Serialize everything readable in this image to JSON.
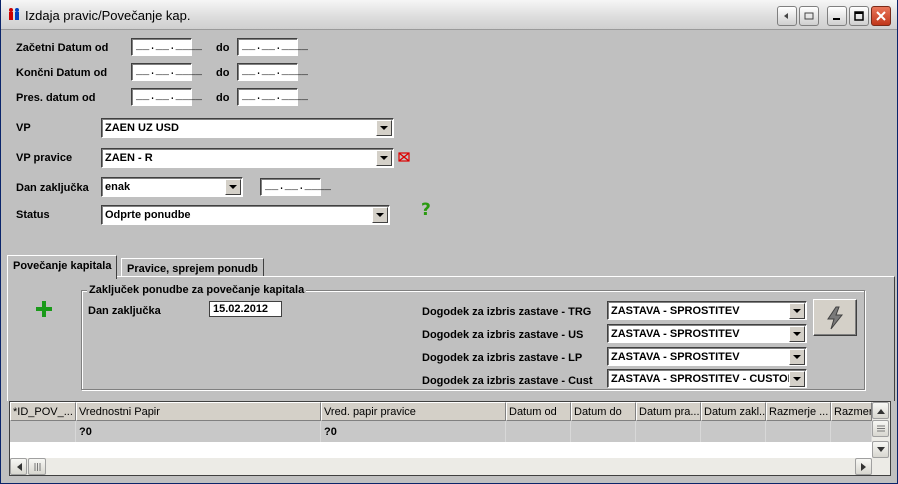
{
  "window": {
    "title": "Izdaja pravic/Povečanje kap.",
    "accent": "#0a246a"
  },
  "filters": {
    "zacetni_datum_label": "Začetni Datum  od",
    "koncni_datum_label": "Končni Datum od",
    "pres_datum_label": "Pres. datum od",
    "do_label": "do",
    "date_placeholder": "__.__.____"
  },
  "vp": {
    "label": "VP",
    "value": "ZAEN UZ USD"
  },
  "vp_pravice": {
    "label": "VP pravice",
    "value": "ZAEN - R"
  },
  "dan_zakljucka": {
    "label": "Dan zaključka",
    "operator": "enak",
    "date": "__.__.____"
  },
  "status": {
    "label": "Status",
    "value": "Odprte ponudbe"
  },
  "tabs": [
    {
      "label": "Povečanje kapitala",
      "active": true
    },
    {
      "label": "Pravice, sprejem ponudb",
      "active": false
    }
  ],
  "group": {
    "title": "Zaključek ponudbe za povečanje kapitala",
    "dan_zakljucka_label": "Dan zaključka",
    "dan_zakljucka_value": "15.02.2012",
    "events": [
      {
        "label": "Dogodek za izbris zastave - TRG",
        "value": "ZASTAVA - SPROSTITEV"
      },
      {
        "label": "Dogodek za izbris zastave - US",
        "value": "ZASTAVA - SPROSTITEV"
      },
      {
        "label": "Dogodek za izbris zastave - LP",
        "value": "ZASTAVA - SPROSTITEV"
      },
      {
        "label": "Dogodek za izbris zastave - Cust",
        "value": "ZASTAVA - SPROSTITEV - CUSTOI"
      }
    ]
  },
  "grid": {
    "columns": [
      "*ID_POV_...",
      "Vrednostni Papir",
      "Vred. papir pravice",
      "Datum od",
      "Datum do",
      "Datum pra...",
      "Datum zakl...",
      "Razmerje ...",
      "Razmerje"
    ],
    "row": [
      "",
      "?0",
      "?0",
      "",
      "",
      "",
      "",
      "",
      ""
    ]
  },
  "icons": {
    "app": "app-people-icon",
    "minimize": "minimize-icon",
    "maximize": "maximize-icon",
    "close": "close-icon",
    "clear": "clear-red-icon",
    "help": "help-question-icon",
    "add": "add-plus-icon",
    "execute": "lightning-icon"
  }
}
